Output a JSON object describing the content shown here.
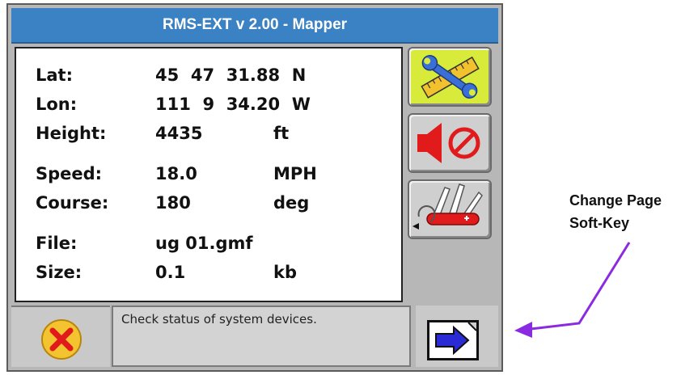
{
  "window": {
    "title": "RMS-EXT v 2.00 - Mapper"
  },
  "readings": [
    {
      "label": "Lat:",
      "value": "45  47  31.88  N",
      "unit": ""
    },
    {
      "label": "Lon:",
      "value": "111  9  34.20  W",
      "unit": ""
    },
    {
      "label": "Height:",
      "value": "4435",
      "unit": "ft"
    },
    {
      "label": "Speed:",
      "value": "18.0",
      "unit": "MPH"
    },
    {
      "label": "Course:",
      "value": "180",
      "unit": "deg"
    },
    {
      "label": "File:",
      "value": "ug 01.gmf",
      "unit": ""
    },
    {
      "label": "Size:",
      "value": "0.1",
      "unit": "kb"
    }
  ],
  "softkeys": [
    {
      "icon": "tools-wrench-ruler-icon",
      "state": "active"
    },
    {
      "icon": "speaker-muted-icon",
      "state": "normal"
    },
    {
      "icon": "multitool-knife-icon",
      "state": "normal"
    }
  ],
  "status": {
    "message": "Check status of system devices."
  },
  "exit": {
    "icon": "x-circle-icon"
  },
  "page_key": {
    "icon": "arrow-right-page-icon"
  },
  "annotation": {
    "line1": "Change Page",
    "line2": "Soft-Key"
  },
  "colors": {
    "titlebar": "#3a82c4",
    "active_key": "#d8ea3a",
    "arrow": "#8a2be2"
  }
}
